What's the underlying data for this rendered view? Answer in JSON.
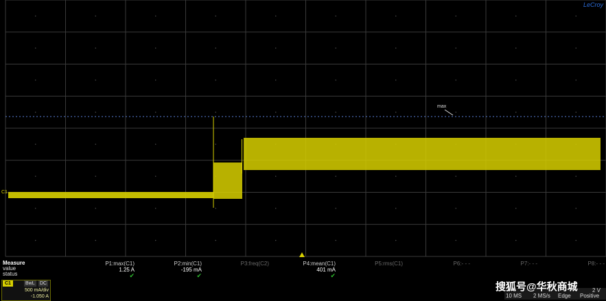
{
  "brand": "LeCroy",
  "max_cursor_label": "max",
  "channel_marker": "C1",
  "colors": {
    "trace": "#d8d000",
    "grid": "#3a3a3a",
    "cursor": "#5a7fd8",
    "pass": "#2fbf2f"
  },
  "measure": {
    "title": "Measure",
    "row_value": "value",
    "row_status": "status",
    "params": [
      {
        "label": "P1:max(C1)",
        "value": "1.25 A",
        "status": "✔"
      },
      {
        "label": "P2:min(C1)",
        "value": "-195 mA",
        "status": "✔"
      },
      {
        "label": "P3:freq(C2)",
        "value": "",
        "status": ""
      },
      {
        "label": "P4:mean(C1)",
        "value": "401 mA",
        "status": "✔"
      },
      {
        "label": "P5:rms(C1)",
        "value": "",
        "status": ""
      },
      {
        "label": "P6:- - -",
        "value": "",
        "status": ""
      },
      {
        "label": "P7:- - -",
        "value": "",
        "status": ""
      },
      {
        "label": "P8:- - -",
        "value": "",
        "status": ""
      }
    ]
  },
  "channel": {
    "tag": "C1",
    "bw": "BwL",
    "coupling": "DC",
    "vdiv": "500 mA/div",
    "offset": "-1.050 A"
  },
  "timebase": {
    "scale": "10 MS",
    "rate": "2 MS/s",
    "trigger": "Edge",
    "slope": "Positive",
    "level": "2 V"
  },
  "watermark": "搜狐号@华秋商城"
}
